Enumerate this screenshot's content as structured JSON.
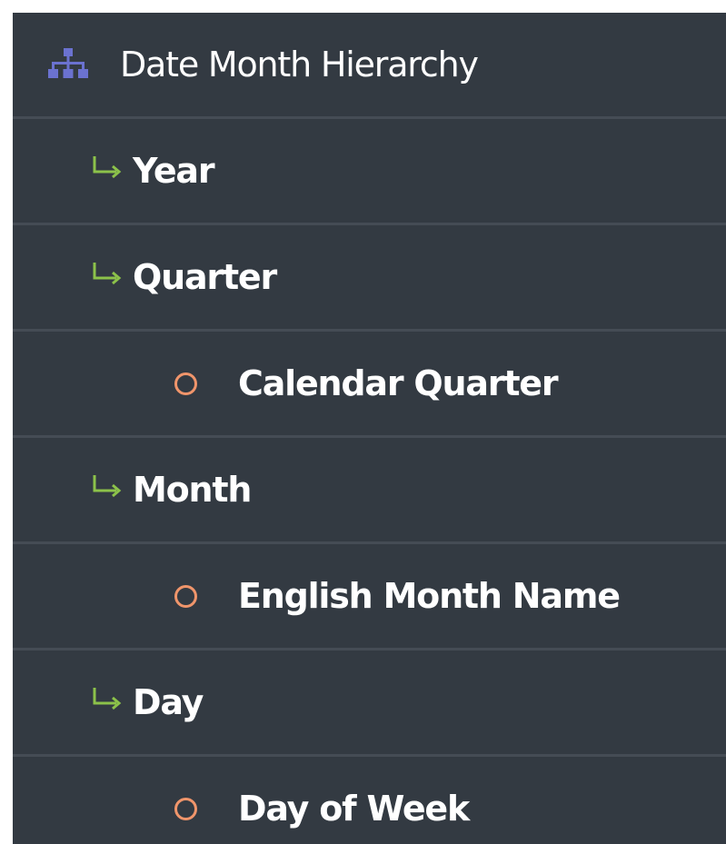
{
  "colors": {
    "panel_background": "#333a42",
    "row_divider": "#454c55",
    "text": "#ffffff",
    "hierarchy_icon": "#6b72d0",
    "level_arrow": "#8cc24a",
    "attribute_circle": "#f0956b"
  },
  "hierarchy": {
    "label": "Date Month Hierarchy",
    "icon": "hierarchy-icon"
  },
  "items": [
    {
      "type": "level",
      "label": "Year",
      "icon": "level-arrow-icon"
    },
    {
      "type": "level",
      "label": "Quarter",
      "icon": "level-arrow-icon"
    },
    {
      "type": "attribute",
      "label": "Calendar Quarter",
      "icon": "attribute-circle-icon"
    },
    {
      "type": "level",
      "label": "Month",
      "icon": "level-arrow-icon"
    },
    {
      "type": "attribute",
      "label": "English Month Name",
      "icon": "attribute-circle-icon"
    },
    {
      "type": "level",
      "label": "Day",
      "icon": "level-arrow-icon"
    },
    {
      "type": "attribute",
      "label": "Day of Week",
      "icon": "attribute-circle-icon"
    }
  ]
}
